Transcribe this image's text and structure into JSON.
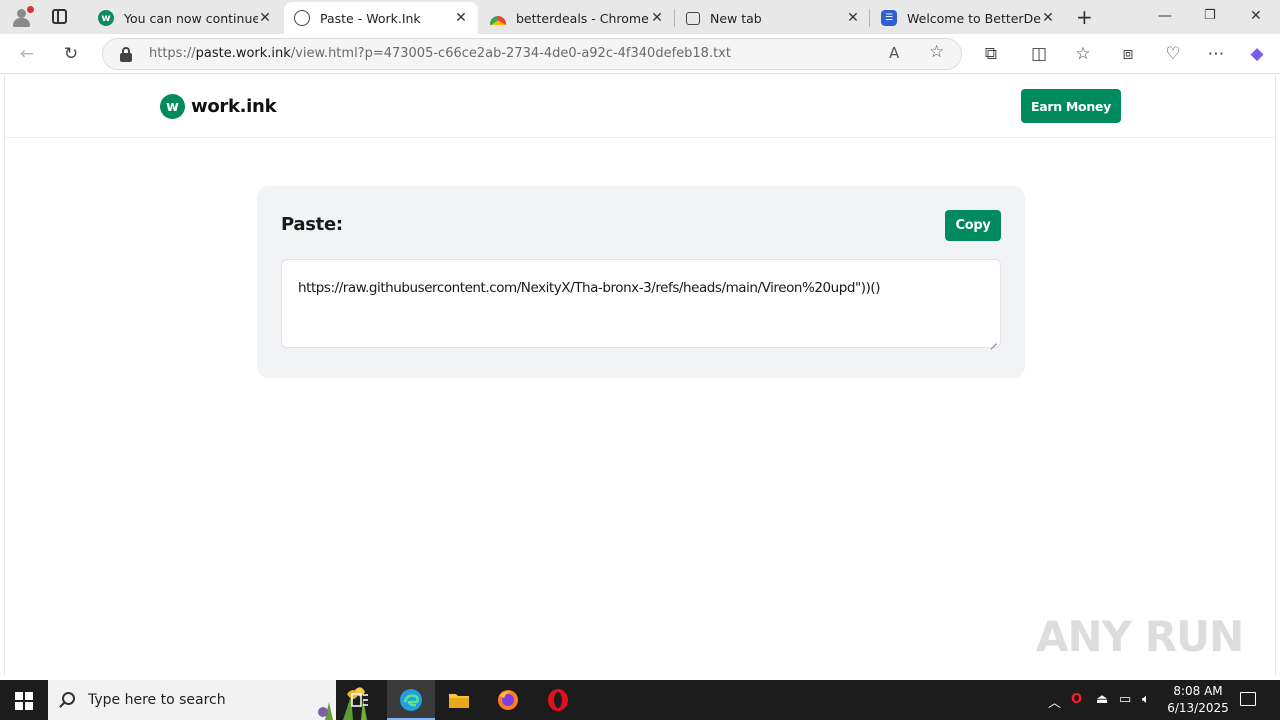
{
  "browser": {
    "tabs": [
      {
        "title": "You can now continue!",
        "favicon": "work-ink-icon",
        "active": false
      },
      {
        "title": "Paste - Work.Ink",
        "favicon": "globe-icon",
        "active": true
      },
      {
        "title": "betterdeals - Chrome We",
        "favicon": "rainbow-icon",
        "active": false
      },
      {
        "title": "New tab",
        "favicon": "new-tab-page-icon",
        "active": false
      },
      {
        "title": "Welcome to BetterDeals",
        "favicon": "betterdeals-icon",
        "active": false
      }
    ],
    "url_prefix": "https://",
    "url_host": "paste.work.ink",
    "url_path": "/view.html?p=473005-c66ce2ab-2734-4de0-a92c-4f340defeb18.txt"
  },
  "site": {
    "logo_mark": "w",
    "logo_text": "work.ink",
    "earn_button": "Earn Money",
    "accent_color": "#008b5e"
  },
  "paste": {
    "title": "Paste:",
    "copy_button": "Copy",
    "content": "https://raw.githubusercontent.com/NexityX/Tha-bronx-3/refs/heads/main/Vireon%20upd\"))()"
  },
  "watermark": "ANY RUN",
  "taskbar": {
    "search_placeholder": "Type here to search",
    "time": "8:08 AM",
    "date": "6/13/2025"
  }
}
